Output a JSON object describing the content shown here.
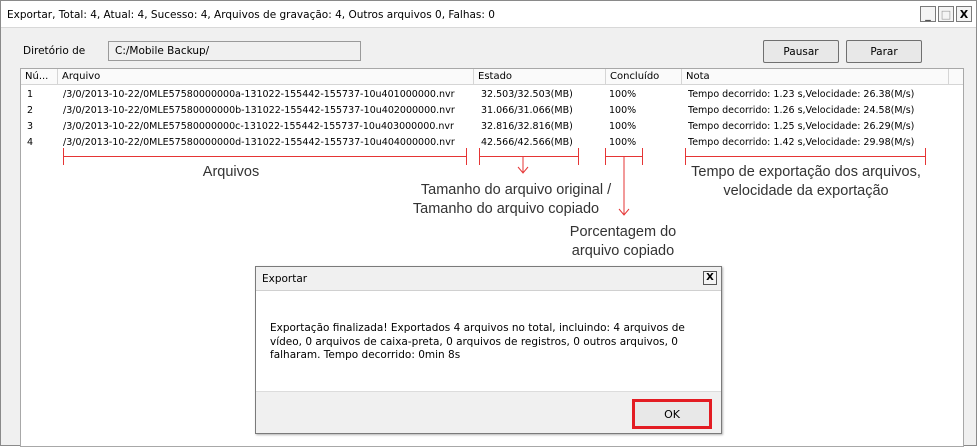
{
  "window": {
    "title": "Exportar, Total: 4, Atual: 4, Sucesso: 4, Arquivos de gravação: 4, Outros arquivos 0, Falhas: 0",
    "minimize": "_",
    "maximize": "□",
    "close": "X"
  },
  "toolbar": {
    "dir_label": "Diretório de",
    "dir_value": "C:/Mobile Backup/",
    "pause_label": "Pausar",
    "stop_label": "Parar"
  },
  "table": {
    "headers": [
      "Nú...",
      "Arquivo",
      "Estado",
      "Concluído",
      "Nota"
    ],
    "rows": [
      [
        "1",
        "/3/0/2013-10-22/0MLE57580000000a-131022-155442-155737-10u401000000.nvr",
        "32.503/32.503(MB)",
        "100%",
        "Tempo decorrido: 1.23 s,Velocidade: 26.38(M/s)"
      ],
      [
        "2",
        "/3/0/2013-10-22/0MLE57580000000b-131022-155442-155737-10u402000000.nvr",
        "31.066/31.066(MB)",
        "100%",
        "Tempo decorrido: 1.26 s,Velocidade: 24.58(M/s)"
      ],
      [
        "3",
        "/3/0/2013-10-22/0MLE57580000000c-131022-155442-155737-10u403000000.nvr",
        "32.816/32.816(MB)",
        "100%",
        "Tempo decorrido: 1.25 s,Velocidade: 26.29(M/s)"
      ],
      [
        "4",
        "/3/0/2013-10-22/0MLE57580000000d-131022-155442-155737-10u404000000.nvr",
        "42.566/42.566(MB)",
        "100%",
        "Tempo decorrido: 1.42 s,Velocidade: 29.98(M/s)"
      ]
    ]
  },
  "annotations": {
    "files": "Arquivos",
    "size_line1": "Tamanho do arquivo original /",
    "size_line2": "Tamanho do arquivo copiado",
    "pct_line1": "Porcentagem do",
    "pct_line2": "arquivo copiado",
    "note_line1": "Tempo de exportação dos arquivos,",
    "note_line2": "velocidade da exportação",
    "color": "#e53535"
  },
  "dialog": {
    "title": "Exportar",
    "close": "X",
    "message": "Exportação finalizada! Exportados 4 arquivos no total, incluindo: 4 arquivos de vídeo, 0 arquivos de caixa-preta, 0 arquivos de registros, 0 outros arquivos, 0 falharam. Tempo decorrido: 0min 8s",
    "ok_label": "OK",
    "ok_highlight_color": "#e31c23"
  }
}
